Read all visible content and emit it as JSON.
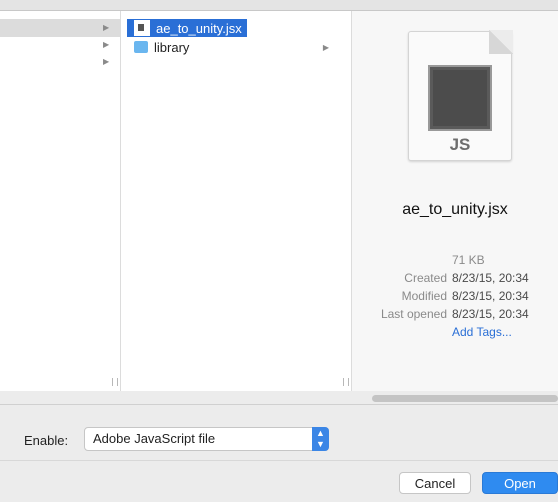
{
  "columns": {
    "col2": {
      "items": [
        {
          "label": "ae_to_unity.jsx",
          "icon": "document-icon",
          "selected": true
        },
        {
          "label": "library",
          "icon": "folder-icon",
          "selected": false
        }
      ]
    }
  },
  "preview": {
    "icon_label": "JS",
    "file_name": "ae_to_unity.jsx",
    "size": "71 KB",
    "created_label": "Created",
    "created_value": "8/23/15, 20:34",
    "modified_label": "Modified",
    "modified_value": "8/23/15, 20:34",
    "last_opened_label": "Last opened",
    "last_opened_value": "8/23/15, 20:34",
    "add_tags": "Add Tags..."
  },
  "footer": {
    "enable_label": "Enable:",
    "enable_value": "Adobe JavaScript file",
    "cancel_label": "Cancel",
    "open_label": "Open"
  },
  "colors": {
    "accent": "#2a6fd6",
    "primary_button": "#2f8bf0"
  }
}
